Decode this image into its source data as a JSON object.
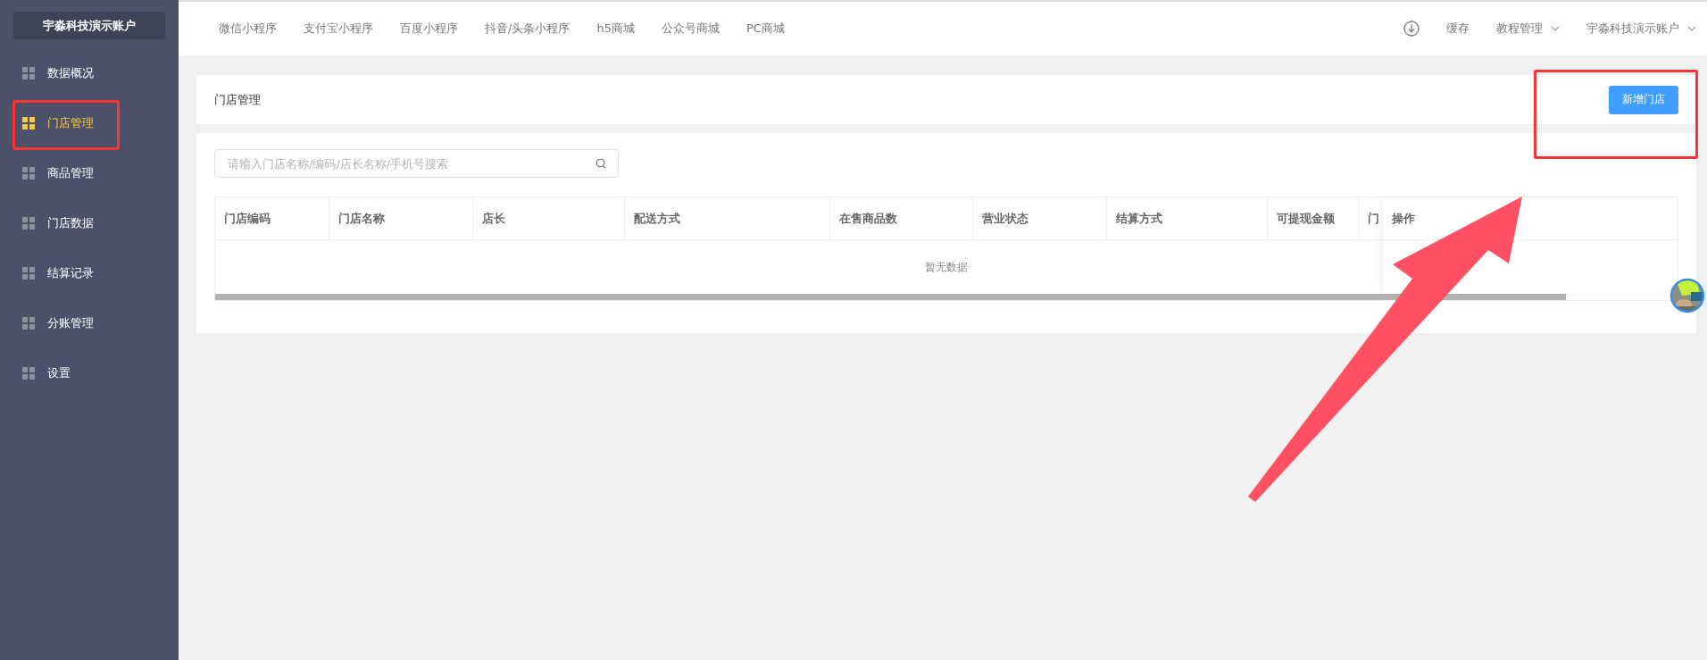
{
  "sidebar": {
    "account": "宇淼科技演示账户",
    "items": [
      {
        "label": "数据概况",
        "selected": false
      },
      {
        "label": "门店管理",
        "selected": true
      },
      {
        "label": "商品管理",
        "selected": false
      },
      {
        "label": "门店数据",
        "selected": false
      },
      {
        "label": "结算记录",
        "selected": false
      },
      {
        "label": "分账管理",
        "selected": false
      },
      {
        "label": "设置",
        "selected": false
      }
    ]
  },
  "top_nav": {
    "links": [
      "微信小程序",
      "支付宝小程序",
      "百度小程序",
      "抖音/头条小程序",
      "h5商城",
      "公众号商城",
      "PC商城"
    ],
    "right": [
      {
        "kind": "icon"
      },
      {
        "kind": "link",
        "label": "缓存"
      },
      {
        "kind": "menu",
        "label": "教程管理"
      },
      {
        "kind": "menu",
        "label": "宇淼科技演示账户"
      }
    ]
  },
  "page_header": {
    "title": "门店管理",
    "button": "新增门店"
  },
  "search": {
    "placeholder": "请输入门店名称/编码/店长名称/手机号搜索"
  },
  "table": {
    "columns": [
      "门店编码",
      "门店名称",
      "店长",
      "配送方式",
      "在售商品数",
      "营业状态",
      "结算方式",
      "可提现金额",
      "门"
    ],
    "fixed_column": "操作",
    "empty_text": "暂无数据"
  }
}
